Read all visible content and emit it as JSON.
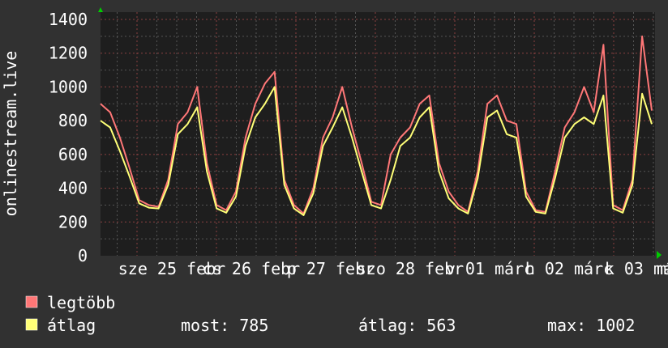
{
  "chart_data": {
    "type": "line",
    "ylabel": "onlinestream.live",
    "ylim": [
      0,
      1400
    ],
    "yticks": [
      0,
      200,
      400,
      600,
      800,
      1000,
      1200,
      1400
    ],
    "xtick_labels": [
      "sze 25 febr",
      "cs 26 febr",
      "p 27 febr",
      "szo 28 febr",
      "v 01 márc",
      "h 02 márc",
      "k 03 márc",
      "márc"
    ],
    "grid": true,
    "colors": {
      "background": "#313131",
      "plot": "#1e1e1e",
      "grid_minor": "#555555",
      "grid_major": "#8a4040",
      "axis_arrow": "#00cc00"
    },
    "series": [
      {
        "name": "legtöbb",
        "color": "#ff7777",
        "values": [
          900,
          850,
          700,
          520,
          330,
          300,
          290,
          450,
          780,
          850,
          1000,
          550,
          300,
          270,
          380,
          700,
          900,
          1020,
          1090,
          450,
          300,
          250,
          400,
          700,
          820,
          1000,
          760,
          550,
          320,
          300,
          600,
          700,
          760,
          900,
          950,
          550,
          380,
          300,
          260,
          500,
          900,
          950,
          800,
          780,
          380,
          270,
          260,
          500,
          760,
          850,
          1000,
          850,
          1250,
          300,
          270,
          450,
          1300,
          860
        ]
      },
      {
        "name": "átlag",
        "color": "#ffff77",
        "values": [
          800,
          760,
          620,
          470,
          310,
          285,
          280,
          420,
          720,
          780,
          880,
          500,
          280,
          255,
          350,
          650,
          820,
          900,
          1000,
          420,
          280,
          240,
          370,
          650,
          760,
          880,
          700,
          500,
          300,
          280,
          450,
          650,
          700,
          820,
          880,
          500,
          340,
          280,
          250,
          460,
          820,
          860,
          720,
          700,
          350,
          260,
          250,
          460,
          700,
          780,
          820,
          780,
          950,
          280,
          255,
          420,
          960,
          780
        ]
      }
    ]
  },
  "legend": {
    "max_label": "legtöbb",
    "avg_label": "átlag",
    "stats": {
      "now": "most: 785",
      "avg": "átlag: 563",
      "max": "max: 1002"
    }
  }
}
